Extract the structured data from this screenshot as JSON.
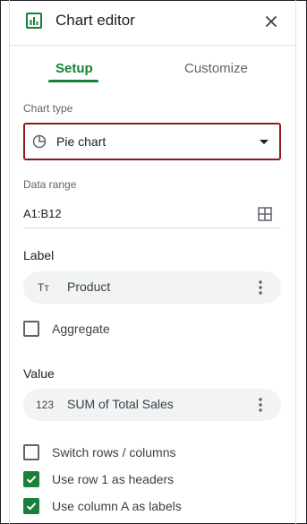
{
  "header": {
    "title": "Chart editor",
    "icon": "chart-icon",
    "close_icon": "close-icon"
  },
  "tabs": [
    {
      "label": "Setup",
      "active": true
    },
    {
      "label": "Customize",
      "active": false
    }
  ],
  "chart_type": {
    "label": "Chart type",
    "value": "Pie chart",
    "icon": "pie-chart-icon"
  },
  "data_range": {
    "label": "Data range",
    "value": "A1:B12",
    "icon": "grid-select-icon"
  },
  "label_section": {
    "title": "Label",
    "chip_icon": "Tт",
    "chip_text": "Product"
  },
  "aggregate": {
    "label": "Aggregate",
    "checked": false
  },
  "value_section": {
    "title": "Value",
    "chip_icon": "123",
    "chip_text": "SUM of Total Sales"
  },
  "options": [
    {
      "label": "Switch rows / columns",
      "checked": false
    },
    {
      "label": "Use row 1 as headers",
      "checked": true
    },
    {
      "label": "Use column A as labels",
      "checked": true
    }
  ],
  "colors": {
    "accent": "#188038",
    "focus_border": "#8a1c1c",
    "chip_bg": "#f1f3f4"
  }
}
